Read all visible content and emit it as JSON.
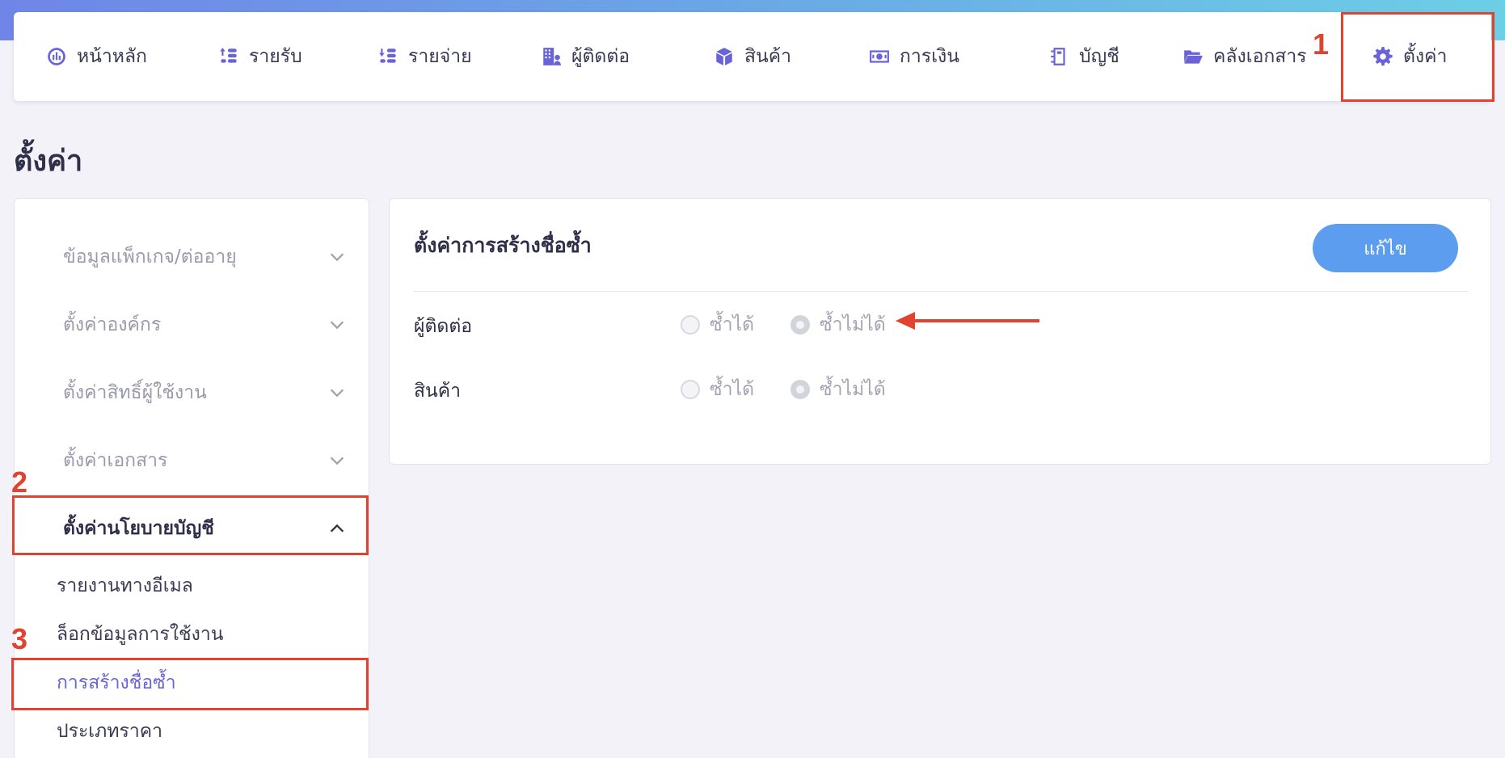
{
  "nav": {
    "items": [
      {
        "label": "หน้าหลัก",
        "icon": "dashboard-icon"
      },
      {
        "label": "รายรับ",
        "icon": "coins-up-icon"
      },
      {
        "label": "รายจ่าย",
        "icon": "coins-down-icon"
      },
      {
        "label": "ผู้ติดต่อ",
        "icon": "contacts-building-icon"
      },
      {
        "label": "สินค้า",
        "icon": "box-icon"
      },
      {
        "label": "การเงิน",
        "icon": "money-icon"
      },
      {
        "label": "บัญชี",
        "icon": "ledger-icon"
      },
      {
        "label": "คลังเอกสาร",
        "icon": "folder-icon"
      },
      {
        "label": "ตั้งค่า",
        "icon": "gear-icon"
      }
    ]
  },
  "markers": {
    "one": "1",
    "two": "2",
    "three": "3"
  },
  "page_title": "ตั้งค่า",
  "sidebar": {
    "groups": [
      {
        "label": "ข้อมูลแพ็กเกจ/ต่ออายุ"
      },
      {
        "label": "ตั้งค่าองค์กร"
      },
      {
        "label": "ตั้งค่าสิทธิ์ผู้ใช้งาน"
      },
      {
        "label": "ตั้งค่าเอกสาร"
      },
      {
        "label": "ตั้งค่านโยบายบัญชี"
      }
    ],
    "sub_items": [
      {
        "label": "รายงานทางอีเมล"
      },
      {
        "label": "ล็อกข้อมูลการใช้งาน"
      },
      {
        "label": "การสร้างชื่อซ้ำ"
      },
      {
        "label": "ประเภทราคา"
      }
    ]
  },
  "panel": {
    "title": "ตั้งค่าการสร้างชื่อซ้ำ",
    "edit_label": "แก้ไข",
    "rows": [
      {
        "label": "ผู้ติดต่อ",
        "option_allow": "ซ้ำได้",
        "option_deny": "ซ้ำไม่ได้",
        "selected": "ซ้ำไม่ได้"
      },
      {
        "label": "สินค้า",
        "option_allow": "ซ้ำได้",
        "option_deny": "ซ้ำไม่ได้",
        "selected": "ซ้ำไม่ได้"
      }
    ]
  },
  "colors": {
    "accent": "#6a63d8",
    "button": "#5c9df0",
    "annotation": "#e04330"
  }
}
